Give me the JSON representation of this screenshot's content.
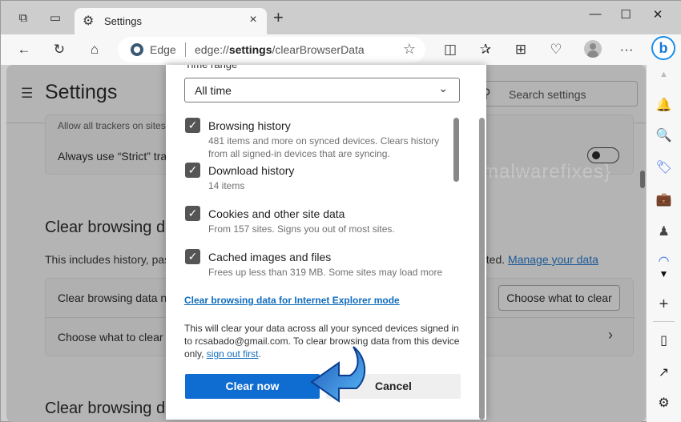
{
  "browser": {
    "tab": {
      "title": "Settings",
      "icon": "gear-icon"
    },
    "new_tab_label": "+",
    "window_controls": {
      "minimize": "—",
      "maximize": "☐",
      "close": "✕"
    },
    "address": {
      "site_label": "Edge",
      "url_prefix": "edge://",
      "url_bold": "settings",
      "url_suffix": "/clearBrowserData"
    },
    "bing_label": "b"
  },
  "page": {
    "title": "Settings",
    "search_placeholder": "Search settings",
    "tracker_text": "Allow all trackers on sites",
    "strict_text": "Always use “Strict” tracking prevention when browsing InPrivate",
    "strict_toggle_on": false,
    "section_title": "Clear browsing data",
    "section_desc": "This includes history, passwords, cookies, and more. Only data from this profile will be deleted.",
    "section_desc_visible_end": "eted.",
    "manage_link": "Manage your data",
    "clear_now_row": "Clear browsing data now",
    "choose_button": "Choose what to clear",
    "choose_row": "Choose what to clear every time you close the browser",
    "section_title_2": "Clear browsing data",
    "watermark": "{malwarefixes}"
  },
  "dialog": {
    "time_range_label": "Time range",
    "time_range_value": "All time",
    "items": [
      {
        "title": "Browsing history",
        "subtitle": "481 items and more on synced devices. Clears history from all signed-in devices that are syncing.",
        "checked": true
      },
      {
        "title": "Download history",
        "subtitle": "14 items",
        "checked": true
      },
      {
        "title": "Cookies and other site data",
        "subtitle": "From 157 sites. Signs you out of most sites.",
        "checked": true
      },
      {
        "title": "Cached images and files",
        "subtitle": "Frees up less than 319 MB. Some sites may load more",
        "checked": true
      }
    ],
    "ie_link": "Clear browsing data for Internet Explorer mode",
    "note_prefix": "This will clear your data across all your synced devices signed in to rcsabado@gmail.com. To clear browsing data from this device only, ",
    "note_link": "sign out first",
    "note_suffix": ".",
    "clear_button": "Clear now",
    "cancel_button": "Cancel"
  },
  "colors": {
    "primary": "#0f6cd0",
    "link": "#0f6cbd",
    "arrow": "#2f8fe0"
  }
}
